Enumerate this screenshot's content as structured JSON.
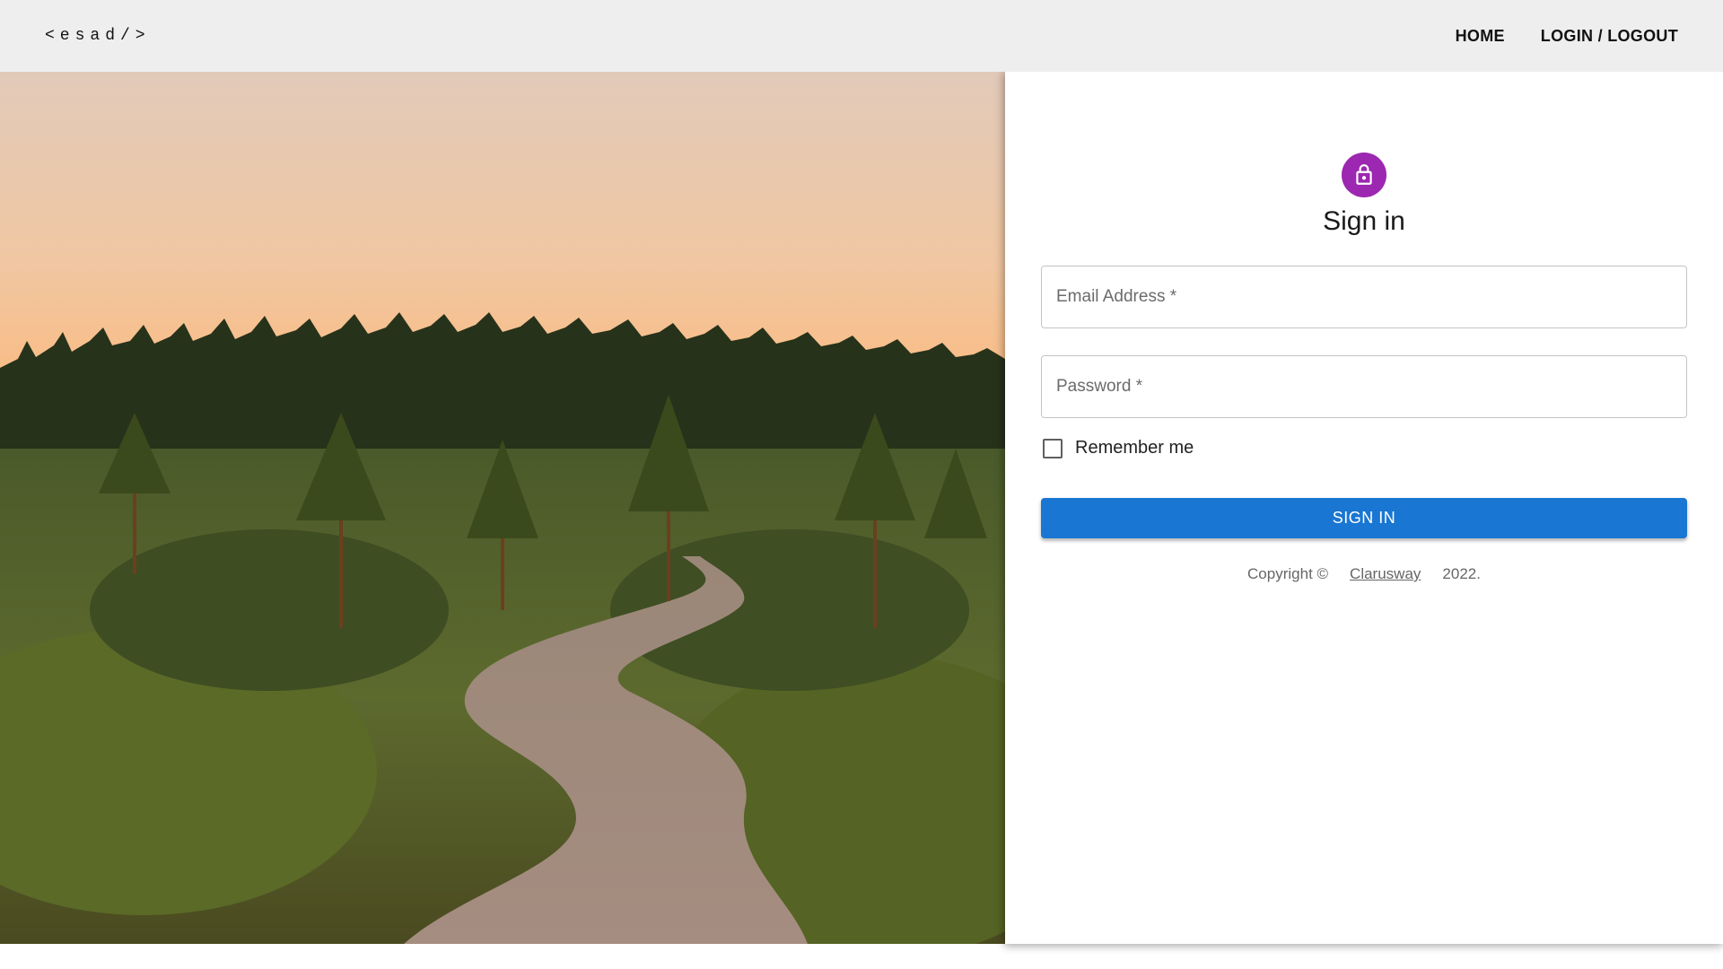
{
  "nav": {
    "brand": "<esad/>",
    "links": [
      "HOME",
      "LOGIN / LOGOUT"
    ]
  },
  "hero": {
    "subject": "forest-path-at-sunset"
  },
  "signin": {
    "icon": "lock-icon",
    "title": "Sign in",
    "email_placeholder": "Email Address *",
    "password_placeholder": "Password *",
    "remember_label": "Remember me",
    "remember_checked": false,
    "button_label": "SIGN IN",
    "footer": {
      "prefix": "Copyright ©",
      "link": "Clarusway",
      "suffix": "2022."
    }
  },
  "colors": {
    "accent": "#1976d2",
    "avatar": "#9c27b0",
    "navbar": "#eeeeee"
  }
}
